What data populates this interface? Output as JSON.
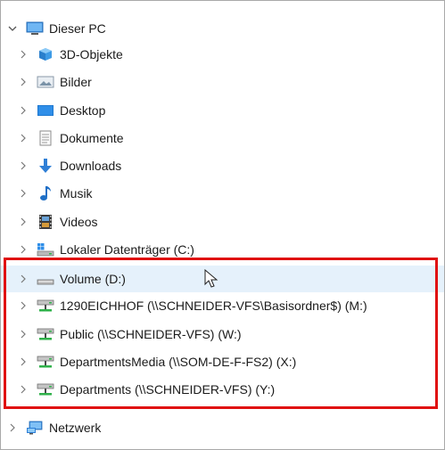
{
  "tree": {
    "root": {
      "label": "Dieser PC",
      "icon": "monitor-icon",
      "expanded": true
    },
    "children": [
      {
        "label": "3D-Objekte",
        "icon": "cube-folder-icon"
      },
      {
        "label": "Bilder",
        "icon": "pictures-folder-icon"
      },
      {
        "label": "Desktop",
        "icon": "desktop-folder-icon"
      },
      {
        "label": "Dokumente",
        "icon": "documents-folder-icon"
      },
      {
        "label": "Downloads",
        "icon": "download-arrow-icon"
      },
      {
        "label": "Musik",
        "icon": "music-note-icon"
      },
      {
        "label": "Videos",
        "icon": "film-icon"
      },
      {
        "label": "Lokaler Datenträger (C:)",
        "icon": "windows-drive-icon"
      },
      {
        "label": "Volume (D:)",
        "icon": "drive-icon"
      },
      {
        "label": "1290EICHHOF (\\\\SCHNEIDER-VFS\\Basisordner$) (M:)",
        "icon": "network-drive-icon"
      },
      {
        "label": "Public (\\\\SCHNEIDER-VFS) (W:)",
        "icon": "network-drive-icon"
      },
      {
        "label": "DepartmentsMedia (\\\\SOM-DE-F-FS2) (X:)",
        "icon": "network-drive-icon"
      },
      {
        "label": "Departments (\\\\SCHNEIDER-VFS) (Y:)",
        "icon": "network-drive-icon"
      }
    ],
    "network": {
      "label": "Netzwerk",
      "icon": "network-icon"
    }
  },
  "colors": {
    "highlight_border": "#e01010",
    "hover_bg": "#e5f1fb"
  }
}
